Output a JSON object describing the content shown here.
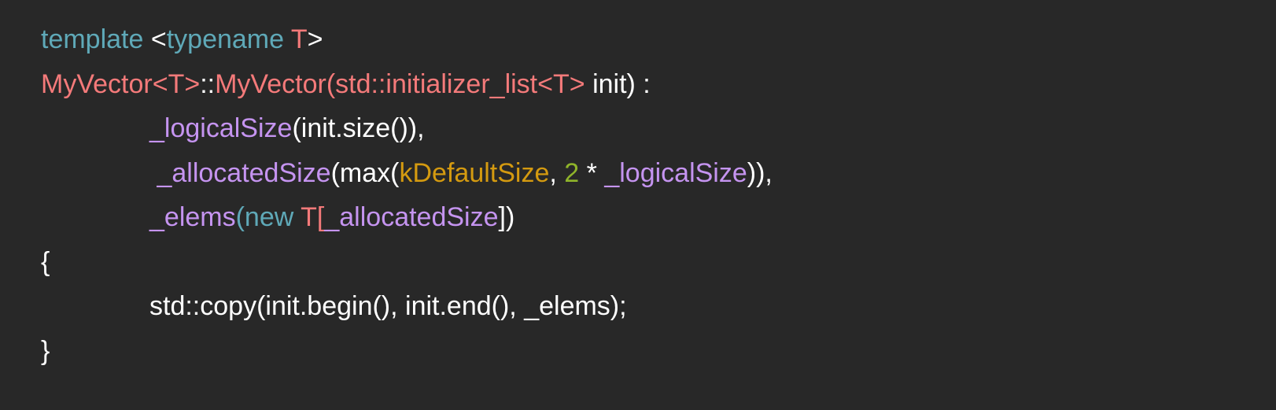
{
  "colors": {
    "w": "#ffffff",
    "k": "#5fa9b8",
    "r": "#f47a7a",
    "p": "#c594f0",
    "o": "#d49a10",
    "g": "#8fb42a"
  },
  "lines": [
    {
      "indent": false,
      "tokens": [
        [
          "template",
          "k"
        ],
        [
          " <",
          "w"
        ],
        [
          "typename",
          "k"
        ],
        [
          " T",
          "r"
        ],
        [
          ">",
          "w"
        ]
      ]
    },
    {
      "indent": false,
      "tokens": [
        [
          "MyVector",
          "r"
        ],
        [
          "<T>",
          "r"
        ],
        [
          "::",
          "w"
        ],
        [
          "MyVector",
          "r"
        ],
        [
          "(std::initializer_list",
          "r"
        ],
        [
          "<T>",
          "r"
        ],
        [
          " init) :",
          "w"
        ]
      ]
    },
    {
      "indent": true,
      "tokens": [
        [
          "_logicalSize",
          "p"
        ],
        [
          "(init.size()),",
          "w"
        ]
      ]
    },
    {
      "indent": true,
      "tokens": [
        [
          " _allocatedSize",
          "p"
        ],
        [
          "(max(",
          "w"
        ],
        [
          "kDefaultSize",
          "o"
        ],
        [
          ", ",
          "w"
        ],
        [
          "2",
          "g"
        ],
        [
          " * ",
          "w"
        ],
        [
          "_logicalSize",
          "p"
        ],
        [
          ")),",
          "w"
        ]
      ]
    },
    {
      "indent": true,
      "tokens": [
        [
          "_elems",
          "p"
        ],
        [
          "(new",
          "k"
        ],
        [
          " T[",
          "r"
        ],
        [
          "_allocatedSize",
          "p"
        ],
        [
          "])",
          "w"
        ]
      ]
    },
    {
      "indent": false,
      "tokens": [
        [
          "{",
          "w"
        ]
      ]
    },
    {
      "indent": true,
      "tokens": [
        [
          "std::copy(init.begin(), init.end(), _elems);",
          "w"
        ]
      ]
    },
    {
      "indent": false,
      "tokens": [
        [
          "}",
          "w"
        ]
      ]
    }
  ]
}
